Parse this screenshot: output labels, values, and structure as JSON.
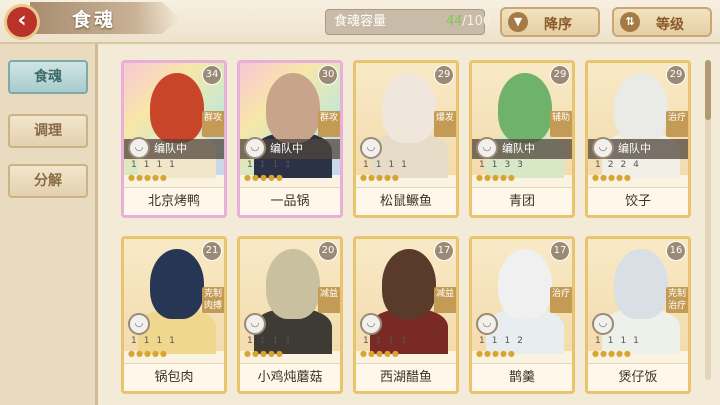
{
  "header": {
    "title": "食魂",
    "capacity_label": "食魂容量",
    "capacity_current": "44",
    "capacity_max": "/100",
    "sort_desc": "降序",
    "sort_level": "等级"
  },
  "sidebar": {
    "items": [
      {
        "label": "食魂"
      },
      {
        "label": "调理"
      },
      {
        "label": "分解"
      }
    ]
  },
  "cards": [
    {
      "name": "北京烤鸭",
      "level": "34",
      "role": "群攻",
      "team": "编队中",
      "stats": "1111",
      "rainbow": true,
      "hair": "#c9452a",
      "cloth": "#f2e6c8"
    },
    {
      "name": "一品锅",
      "level": "30",
      "role": "群攻",
      "team": "编队中",
      "stats": "1111",
      "rainbow": true,
      "hair": "#c8a48a",
      "cloth": "#2b3247"
    },
    {
      "name": "松鼠鳜鱼",
      "level": "29",
      "role": "爆发",
      "team": "",
      "stats": "1111",
      "rainbow": false,
      "hair": "#efe6dc",
      "cloth": "#e7dcc7"
    },
    {
      "name": "青团",
      "level": "29",
      "role": "辅助",
      "team": "编队中",
      "stats": "1133",
      "rainbow": false,
      "hair": "#6fb36a",
      "cloth": "#d8e7c6"
    },
    {
      "name": "饺子",
      "level": "29",
      "role": "治疗",
      "team": "编队中",
      "stats": "1224",
      "rainbow": false,
      "hair": "#eaeae6",
      "cloth": "#f2efe6"
    },
    {
      "name": "锅包肉",
      "level": "21",
      "role": "克制 肉搏",
      "team": "",
      "stats": "1111",
      "rainbow": false,
      "hair": "#283656",
      "cloth": "#f0d78e"
    },
    {
      "name": "小鸡炖蘑菇",
      "level": "20",
      "role": "减益",
      "team": "",
      "stats": "1111",
      "rainbow": false,
      "hair": "#c9c0a0",
      "cloth": "#3e3a34"
    },
    {
      "name": "西湖醋鱼",
      "level": "17",
      "role": "减益",
      "team": "",
      "stats": "1111",
      "rainbow": false,
      "hair": "#5a3a2a",
      "cloth": "#7a2a24"
    },
    {
      "name": "鹊羹",
      "level": "17",
      "role": "治疗",
      "team": "",
      "stats": "1112",
      "rainbow": false,
      "hair": "#f0f0f0",
      "cloth": "#e8eef0"
    },
    {
      "name": "煲仔饭",
      "level": "16",
      "role": "克制 治疗",
      "team": "",
      "stats": "1111",
      "rainbow": false,
      "hair": "#d8e0e6",
      "cloth": "#eef0ea"
    }
  ]
}
